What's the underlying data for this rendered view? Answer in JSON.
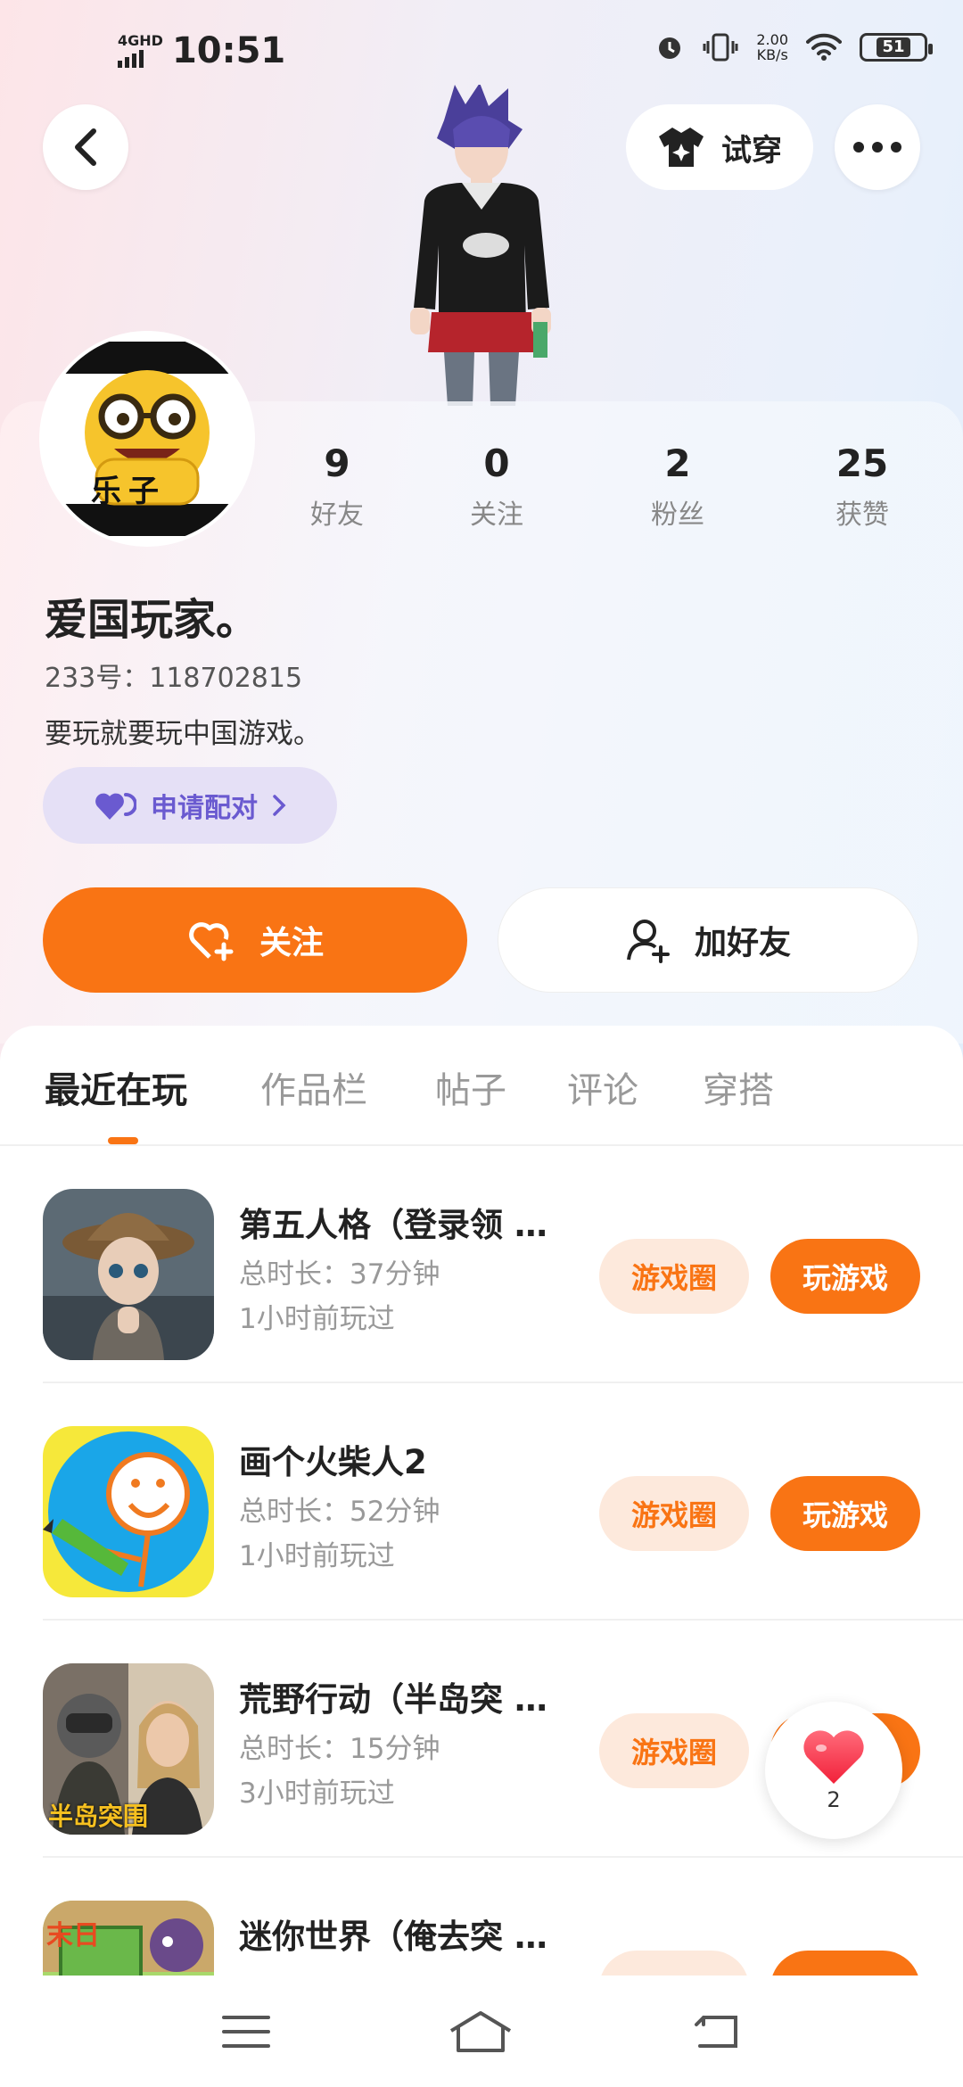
{
  "status_bar": {
    "network": "4GHD",
    "time": "10:51",
    "speed_value": "2.00",
    "speed_unit": "KB/s",
    "battery": "51"
  },
  "header": {
    "try_on_label": "试穿"
  },
  "profile": {
    "stats": [
      {
        "value": "9",
        "label": "好友"
      },
      {
        "value": "0",
        "label": "关注"
      },
      {
        "value": "2",
        "label": "粉丝"
      },
      {
        "value": "25",
        "label": "获赞"
      }
    ],
    "avatar_text": "乐子",
    "nickname": "爱国玩家。",
    "uid_line": "233号：118702815",
    "bio": "要玩就要玩中国游戏。",
    "pair_label": "申请配对",
    "follow_label": "关注",
    "add_friend_label": "加好友"
  },
  "tabs": [
    "最近在玩",
    "作品栏",
    "帖子",
    "评论",
    "穿搭"
  ],
  "games": [
    {
      "title": "第五人格（登录领 …",
      "duration": "总时长：37分钟",
      "last_played": "1小时前玩过",
      "circle_label": "游戏圈",
      "play_label": "玩游戏"
    },
    {
      "title": "画个火柴人2",
      "duration": "总时长：52分钟",
      "last_played": "1小时前玩过",
      "circle_label": "游戏圈",
      "play_label": "玩游戏"
    },
    {
      "title": "荒野行动（半岛突 …",
      "duration": "总时长：15分钟",
      "last_played": "3小时前玩过",
      "circle_label": "游戏圈",
      "play_label": "玩游戏"
    },
    {
      "title": "迷你世界（俺去突 …",
      "duration": "",
      "last_played": "",
      "circle_label": "",
      "play_label": ""
    }
  ],
  "game_icon_text": {
    "wildmission": "半岛突围",
    "mini": "末日"
  },
  "float_like": {
    "count": "2"
  },
  "colors": {
    "accent": "#f97414",
    "accent_light": "#fde9dc",
    "pair_bg": "#e5e0f6",
    "pair_text": "#6a5ad0"
  }
}
